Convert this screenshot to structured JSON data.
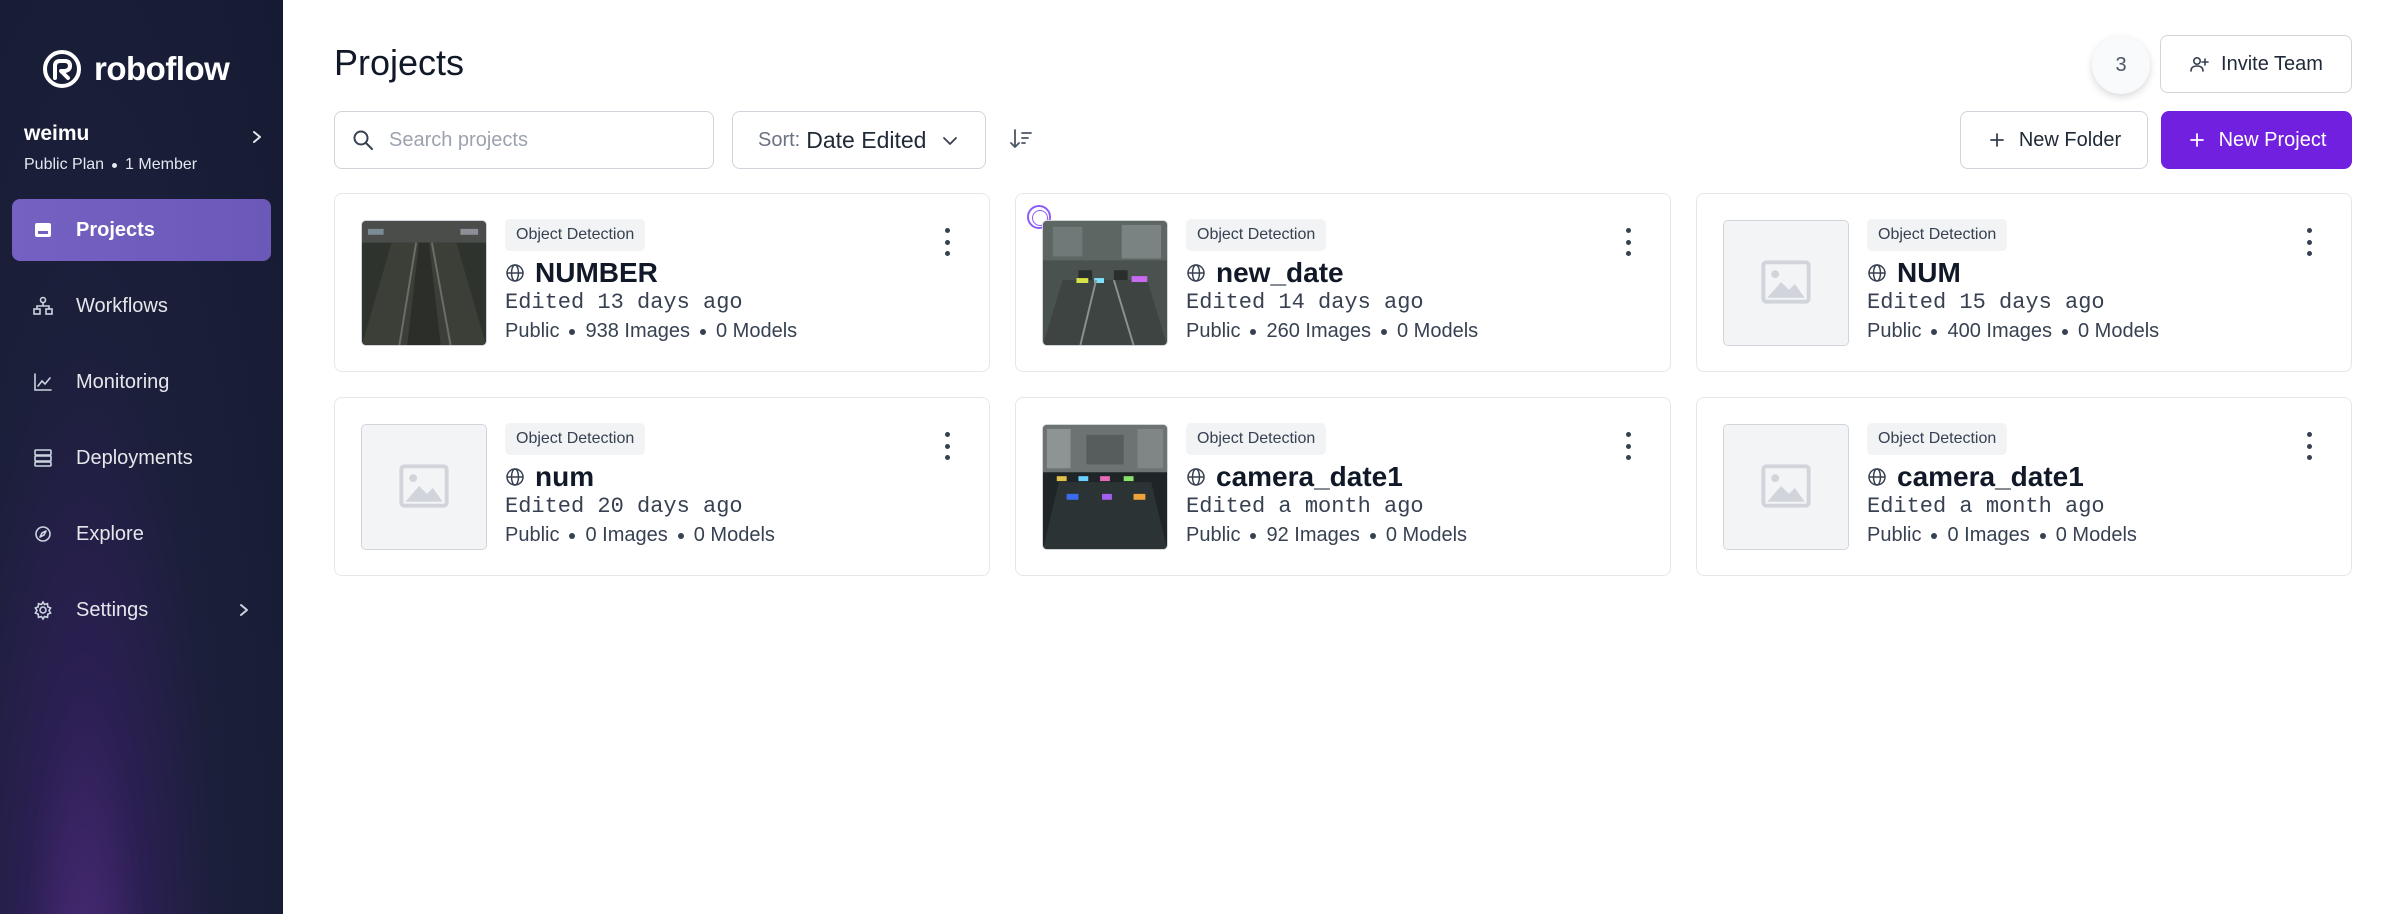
{
  "brand": {
    "name": "roboflow",
    "logo_icon": "roboflow-logo-icon"
  },
  "workspace": {
    "name": "weimu",
    "plan": "Public Plan",
    "members": "1 Member"
  },
  "sidebar": {
    "items": [
      {
        "label": "Projects",
        "icon": "projects-icon",
        "active": true
      },
      {
        "label": "Workflows",
        "icon": "workflows-icon"
      },
      {
        "label": "Monitoring",
        "icon": "monitoring-icon"
      },
      {
        "label": "Deployments",
        "icon": "deployments-icon"
      },
      {
        "label": "Explore",
        "icon": "explore-icon"
      },
      {
        "label": "Settings",
        "icon": "gear-icon",
        "has_chevron": true
      }
    ]
  },
  "header": {
    "title": "Projects",
    "member_count": "3",
    "invite_label": "Invite Team"
  },
  "toolbar": {
    "search_placeholder": "Search projects",
    "sort_prefix": "Sort:",
    "sort_value": "Date Edited",
    "new_folder_label": "New Folder",
    "new_project_label": "New Project"
  },
  "colors": {
    "primary": "#7220e0",
    "sidebar_active": "#7561c2",
    "sidebar_bg": "#161b33"
  },
  "projects": [
    {
      "type": "Object Detection",
      "name": "NUMBER",
      "edited": "Edited 13 days ago",
      "visibility": "Public",
      "images": "938 Images",
      "models": "0 Models",
      "thumbnail": "road-scene"
    },
    {
      "type": "Object Detection",
      "name": "new_date",
      "edited": "Edited 14 days ago",
      "visibility": "Public",
      "images": "260 Images",
      "models": "0 Models",
      "thumbnail": "track-lights-scene"
    },
    {
      "type": "Object Detection",
      "name": "NUM",
      "edited": "Edited 15 days ago",
      "visibility": "Public",
      "images": "400 Images",
      "models": "0 Models",
      "thumbnail": "placeholder"
    },
    {
      "type": "Object Detection",
      "name": "num",
      "edited": "Edited 20 days ago",
      "visibility": "Public",
      "images": "0 Images",
      "models": "0 Models",
      "thumbnail": "placeholder"
    },
    {
      "type": "Object Detection",
      "name": "camera_date1",
      "edited": "Edited a month ago",
      "visibility": "Public",
      "images": "92 Images",
      "models": "0 Models",
      "thumbnail": "lab-scene"
    },
    {
      "type": "Object Detection",
      "name": "camera_date1",
      "edited": "Edited a month ago",
      "visibility": "Public",
      "images": "0 Images",
      "models": "0 Models",
      "thumbnail": "placeholder"
    }
  ]
}
